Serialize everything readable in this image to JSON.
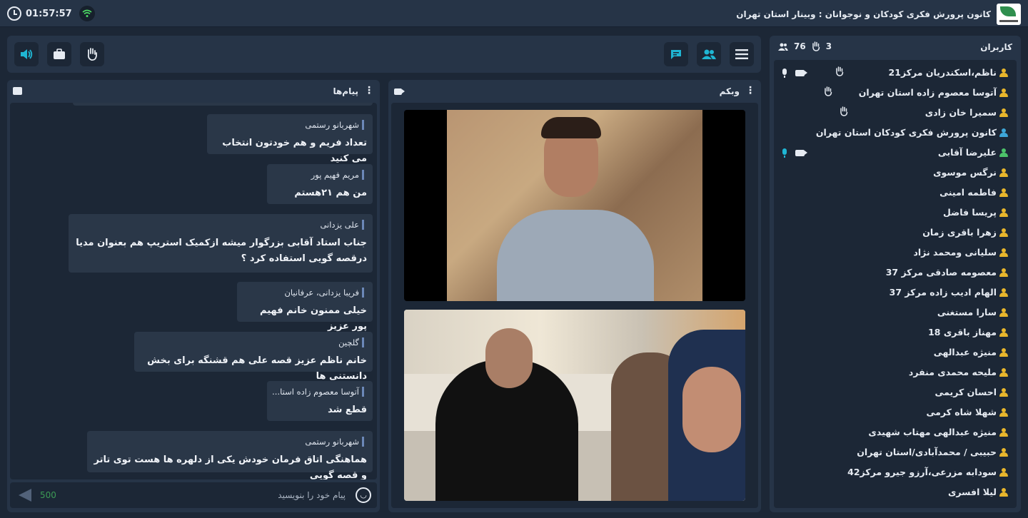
{
  "topbar": {
    "clock": "01:57:57",
    "title": "کانون پرورش فکری کودکان و نوجوانان : وبینار استان تهران",
    "clock_icon": "clock-icon",
    "signal_icon": "wifi-icon"
  },
  "toolbar": {
    "left_buttons": [
      "speaker-icon",
      "briefcase-icon",
      "raise-hand-icon"
    ],
    "right_buttons": [
      "chat-toggle-icon",
      "users-toggle-icon",
      "menu-icon"
    ],
    "accent_color": "#1fb6d4"
  },
  "users": {
    "title": "کاربران",
    "total_count": "76",
    "hands_count": "3",
    "list": [
      {
        "name": "ناظم،اسکندریان مرکز21",
        "role": "user",
        "hand": true,
        "cam": true,
        "mic": true
      },
      {
        "name": "آتوسا معصوم زاده استان تهران",
        "role": "user",
        "hand": true,
        "cam": false,
        "mic": false
      },
      {
        "name": "سمیرا خان زادی",
        "role": "user",
        "hand": true,
        "cam": false,
        "mic": false
      },
      {
        "name": "کانون پرورش فکری کودکان استان تهران",
        "role": "host",
        "hand": false,
        "cam": false,
        "mic": false
      },
      {
        "name": "علیرضا آقابی",
        "role": "presenter",
        "hand": false,
        "cam": true,
        "mic": true
      },
      {
        "name": "نرگس موسوی",
        "role": "user",
        "hand": false,
        "cam": false,
        "mic": false
      },
      {
        "name": "فاطمه امینی",
        "role": "user",
        "hand": false,
        "cam": false,
        "mic": false
      },
      {
        "name": "پریسا فاضل",
        "role": "user",
        "hand": false,
        "cam": false,
        "mic": false
      },
      {
        "name": "زهرا باقری زمان",
        "role": "user",
        "hand": false,
        "cam": false,
        "mic": false
      },
      {
        "name": "سلیانی ومحمد نژاد",
        "role": "user",
        "hand": false,
        "cam": false,
        "mic": false
      },
      {
        "name": "معصومه صادقی مرکز 37",
        "role": "user",
        "hand": false,
        "cam": false,
        "mic": false
      },
      {
        "name": "الهام ادیب زاده مرکز 37",
        "role": "user",
        "hand": false,
        "cam": false,
        "mic": false
      },
      {
        "name": "سارا مستغنی",
        "role": "user",
        "hand": false,
        "cam": false,
        "mic": false
      },
      {
        "name": "مهناز باقری 18",
        "role": "user",
        "hand": false,
        "cam": false,
        "mic": false
      },
      {
        "name": "منیژه عبدالهی",
        "role": "user",
        "hand": false,
        "cam": false,
        "mic": false
      },
      {
        "name": "ملیحه محمدی منفرد",
        "role": "user",
        "hand": false,
        "cam": false,
        "mic": false
      },
      {
        "name": "احسان کریمی",
        "role": "user",
        "hand": false,
        "cam": false,
        "mic": false
      },
      {
        "name": "شهلا شاه کرمی",
        "role": "user",
        "hand": false,
        "cam": false,
        "mic": false
      },
      {
        "name": "منیژه عبدالهی مهتاب شهیدی",
        "role": "user",
        "hand": false,
        "cam": false,
        "mic": false
      },
      {
        "name": "حبیبی / محمدآبادی/استان تهران",
        "role": "user",
        "hand": false,
        "cam": false,
        "mic": false
      },
      {
        "name": "سودابه مزرعی،آرزو جیرو مرکز42",
        "role": "user",
        "hand": false,
        "cam": false,
        "mic": false
      },
      {
        "name": "لیلا افسری",
        "role": "user",
        "hand": false,
        "cam": false,
        "mic": false
      }
    ],
    "colors": {
      "user": "#e8b62c",
      "host": "#3ea6d8",
      "presenter": "#4cc36a",
      "mic_active": "#1fb6d4"
    }
  },
  "chat": {
    "title": "پیام‌ها",
    "messages": [
      {
        "sender": "شهربانو رستمی",
        "text": "تعداد فریم و هم خودتون انتخاب می کنید"
      },
      {
        "sender": "مریم فهیم پور",
        "text": "من هم ۲۱هستم"
      },
      {
        "sender": "علی یزدانی",
        "text": "جناب استاد آقابی بزرگوار میشه ازکمیک استریپ هم بعنوان مدیا درقصه گویی استفاده کرد ؟"
      },
      {
        "sender": "فریبا یزدانی، عرفانیان",
        "text": "خیلی ممنون خانم فهیم پور عزیز"
      },
      {
        "sender": "گلچین",
        "text": "خانم ناظم عزیز قصه علی هم قشنگه برای بخش دانستنی ها"
      },
      {
        "sender": "آتوسا معصوم زاده استا...",
        "text": "قطع شد"
      },
      {
        "sender": "شهربانو رستمی",
        "text": "هماهنگی اتاق فرمان خودش یکی از دلهره ها هست توی تاتر و قصه گویی"
      }
    ],
    "input_placeholder": "پیام خود را بنویسید",
    "char_count": "500"
  },
  "webcam": {
    "title": "وبکم"
  }
}
